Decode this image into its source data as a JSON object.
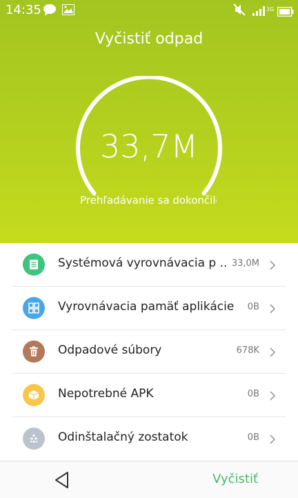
{
  "status": {
    "time": "14:35",
    "network": "3G"
  },
  "title": "Vyčistiť odpad",
  "scan": {
    "size": "33,7M",
    "status_text": "Prehľadávanie sa dokončilo"
  },
  "items": [
    {
      "label": "Systémová vyrovnávacia p ..",
      "value": "33,0M",
      "icon": "document-icon",
      "color": "#3dc47e"
    },
    {
      "label": "Vyrovnávacia pamäť aplikácie",
      "value": "0B",
      "icon": "grid-icon",
      "color": "#4aa6ea"
    },
    {
      "label": "Odpadové súbory",
      "value": "678K",
      "icon": "trash-icon",
      "color": "#b27a5a"
    },
    {
      "label": "Nepotrebné APK",
      "value": "0B",
      "icon": "package-icon",
      "color": "#f8c64a"
    },
    {
      "label": "Odinštalačný zostatok",
      "value": "0B",
      "icon": "residue-icon",
      "color": "#bcc3cc"
    }
  ],
  "bottom": {
    "clean_label": "Vyčistiť"
  },
  "colors": {
    "header_top": "#a3c520",
    "header_bottom": "#c5dc1e",
    "accent": "#45b96a"
  }
}
